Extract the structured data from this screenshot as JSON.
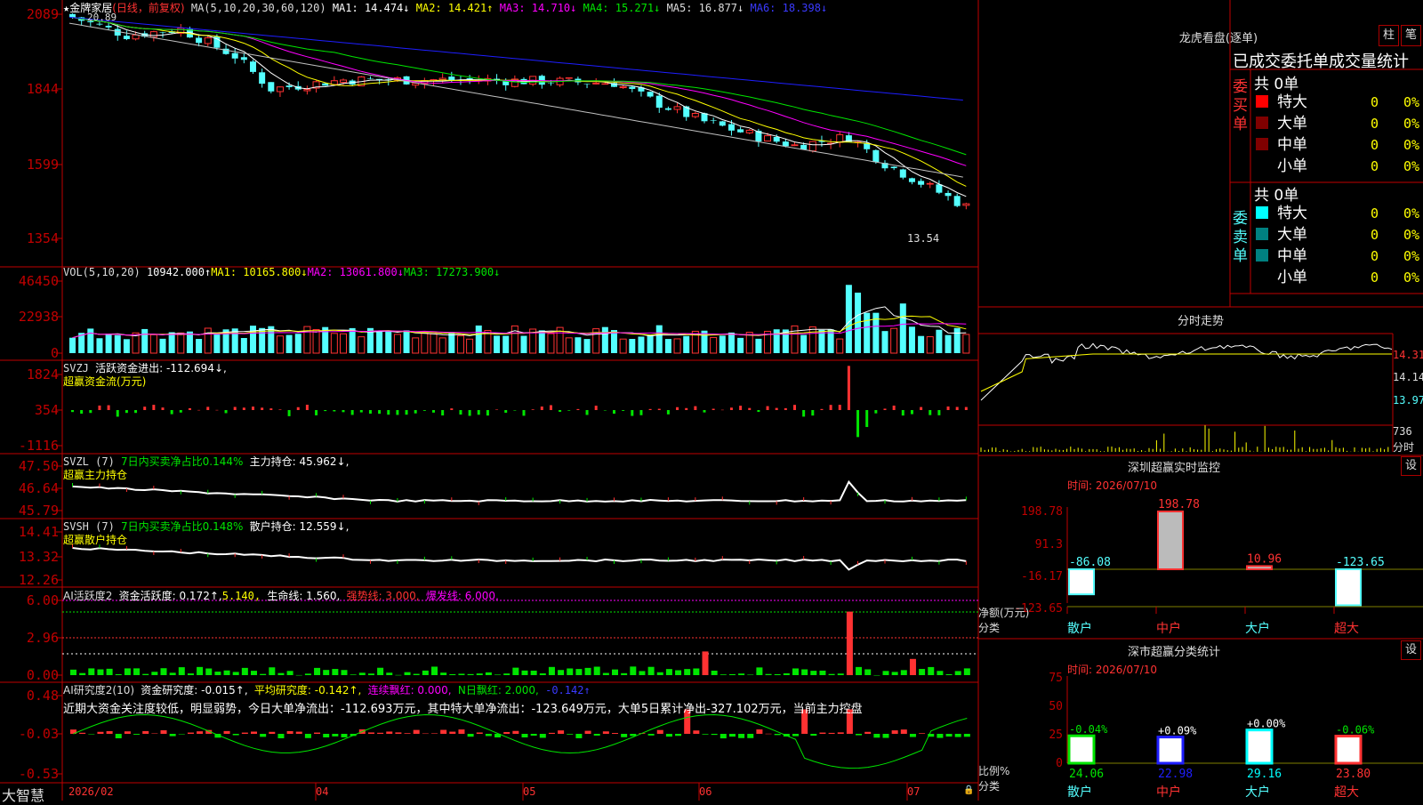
{
  "colors": {
    "up": "#ff3232",
    "down": "#54ffff",
    "grid": "#c00000",
    "ma1": "#ffffff",
    "ma2": "#ffff00",
    "ma3": "#ff00ff",
    "ma4": "#00e600",
    "ma5": "#c0c0c0",
    "ma6": "#1e1eff"
  },
  "main": {
    "title_star": "★",
    "stock": "金牌家居",
    "period": "(日线，前复权)",
    "ma_params": "MA(5,10,20,30,60,120)",
    "ma1": "MA1: 14.474↓",
    "ma2": "MA2: 14.421↑",
    "ma3": "MA3: 14.710↓",
    "ma4": "MA4: 15.271↓",
    "ma5": "MA5: 16.877↓",
    "ma6": "MA6: 18.398↓",
    "high_label": "20.89",
    "low_label": "13.54",
    "y_ticks": [
      "2089",
      "1844",
      "1599",
      "1354"
    ]
  },
  "vol": {
    "params": "VOL(5,10,20)",
    "value": "10942.000↑",
    "ma1": "MA1: 10165.800↓",
    "ma2": "MA2: 13061.800↓",
    "ma3": "MA3: 17273.900↓",
    "y_ticks": [
      "46450",
      "22938",
      "0"
    ]
  },
  "svzj": {
    "name": "SVZJ",
    "label": "活跃资金进出: -112.694↓,",
    "sub": "超赢资金流(万元)",
    "y_ticks": [
      "1824",
      "354",
      "-1116"
    ]
  },
  "svzl": {
    "name": "SVZL (7)",
    "ratio": "7日内买卖净占比0.144%",
    "hold": "主力持仓: 45.962↓,",
    "sub": "超赢主力持仓",
    "y_ticks": [
      "47.50",
      "46.64",
      "45.79"
    ]
  },
  "svsh": {
    "name": "SVSH (7)",
    "ratio": "7日内买卖净占比0.148%",
    "hold": "散户持仓: 12.559↓,",
    "sub": "超赢散户持仓",
    "y_ticks": [
      "14.41",
      "13.32",
      "12.26"
    ]
  },
  "ai1": {
    "name": "AI活跃度2",
    "act": "资金活跃度: 0.172↑,",
    "v2": "5.140,",
    "life": "生命线: 1.560,",
    "strong": "强势线: 3.000,",
    "burst": "爆发线: 6.000,",
    "y_ticks": [
      "6.00",
      "2.96",
      "0.00"
    ]
  },
  "ai2": {
    "name": "AI研究度2(10)",
    "res": "资金研究度: -0.015↑,",
    "avg": "平均研究度: -0.142↑,",
    "cont": "连续飘红: 0.000,",
    "nday": "N日飘红: 2.000,",
    "v5": "-0.142↑",
    "comment": "近期大资金关注度较低，明显弱势，今日大单净流出：-112.693万元，其中特大单净流出：-123.649万元，大单5日累计净出-327.102万元，当前主力控盘",
    "y_ticks": [
      "0.48",
      "-0.03",
      "-0.53"
    ]
  },
  "xaxis": {
    "brand": "大智慧",
    "labels": [
      "2026/02",
      "04",
      "05",
      "06",
      "07"
    ]
  },
  "lhb": {
    "title": "龙虎看盘(逐单)",
    "btn1": "柱",
    "btn2": "笔",
    "header": "已成交委托单成交量统计",
    "buy": {
      "label": "委买单",
      "total": "共 0单",
      "rows": [
        {
          "name": "特大",
          "v": "0",
          "p": "0%"
        },
        {
          "name": "大单",
          "v": "0",
          "p": "0%"
        },
        {
          "name": "中单",
          "v": "0",
          "p": "0%"
        },
        {
          "name": "小单",
          "v": "0",
          "p": "0%"
        }
      ]
    },
    "sell": {
      "label": "委卖单",
      "total": "共 0单",
      "rows": [
        {
          "name": "特大",
          "v": "0",
          "p": "0%"
        },
        {
          "name": "大单",
          "v": "0",
          "p": "0%"
        },
        {
          "name": "中单",
          "v": "0",
          "p": "0%"
        },
        {
          "name": "小单",
          "v": "0",
          "p": "0%"
        }
      ]
    }
  },
  "intraday": {
    "title": "分时走势",
    "p_ticks": [
      "14.31",
      "14.14",
      "13.97"
    ],
    "vol_tick": "736",
    "vol_unit": "分时"
  },
  "monitor": {
    "title": "深圳超赢实时监控",
    "set": "设",
    "date": "时间: 2026/07/10",
    "y_ticks": [
      "198.78",
      "91.3",
      "-16.17",
      "-123.65"
    ],
    "unit": "净额(万元)",
    "cat_label": "分类",
    "cats": [
      "散户",
      "中户",
      "大户",
      "超大"
    ],
    "values": [
      -86.08,
      198.78,
      10.96,
      -123.65
    ],
    "value_labels": [
      "-86.08",
      "198.78",
      "10.96",
      "-123.65"
    ]
  },
  "classstat": {
    "title": "深市超赢分类统计",
    "set": "设",
    "date": "时间: 2026/07/10",
    "y_ticks": [
      "75",
      "50",
      "25",
      "0"
    ],
    "unit": "比例%",
    "cat_label": "分类",
    "cats": [
      "散户",
      "中户",
      "大户",
      "超大"
    ],
    "values": [
      24.06,
      22.98,
      29.16,
      23.8
    ],
    "value_labels": [
      "24.06",
      "22.98",
      "29.16",
      "23.80"
    ],
    "changes": [
      "-0.04%",
      "+0.09%",
      "+0.00%",
      "-0.06%"
    ]
  }
}
